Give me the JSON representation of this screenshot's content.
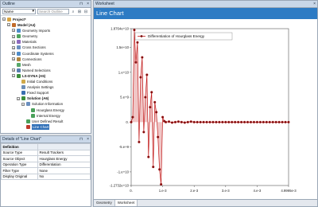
{
  "outline": {
    "title": "Outline",
    "pin": "⊓",
    "close": "×",
    "name_select": "Name",
    "search_placeholder": "Search Outline",
    "tree": [
      {
        "label": "Project*",
        "indent": 0,
        "exp": "−",
        "bold": true,
        "color": "#d9a441"
      },
      {
        "label": "Model (A4)",
        "indent": 1,
        "exp": "−",
        "bold": true,
        "color": "#c26b2a"
      },
      {
        "label": "Geometry Imports",
        "indent": 2,
        "exp": "+",
        "color": "#4f8cc9"
      },
      {
        "label": "Geometry",
        "indent": 2,
        "exp": "+",
        "color": "#4fa35f"
      },
      {
        "label": "Materials",
        "indent": 2,
        "exp": "+",
        "color": "#8e6bbf"
      },
      {
        "label": "Cross Sections",
        "indent": 2,
        "exp": "+",
        "color": "#6b8fbf"
      },
      {
        "label": "Coordinate Systems",
        "indent": 2,
        "exp": "+",
        "color": "#4f8cc9"
      },
      {
        "label": "Connections",
        "indent": 2,
        "exp": "+",
        "color": "#b0853f"
      },
      {
        "label": "Mesh",
        "indent": 2,
        "exp": "",
        "color": "#58a86a"
      },
      {
        "label": "Named Selections",
        "indent": 2,
        "exp": "+",
        "color": "#5a7fb0"
      },
      {
        "label": "LS-DYNA (A5)",
        "indent": 2,
        "exp": "−",
        "bold": true,
        "color": "#3d8f3d"
      },
      {
        "label": "Initial Conditions",
        "indent": 3,
        "exp": "",
        "color": "#d0a94a"
      },
      {
        "label": "Analysis Settings",
        "indent": 3,
        "exp": "",
        "color": "#6d8fb8"
      },
      {
        "label": "Fixed Support",
        "indent": 3,
        "exp": "",
        "color": "#3a6fb0"
      },
      {
        "label": "Solution (A6)",
        "indent": 3,
        "exp": "−",
        "bold": true,
        "color": "#3d8f3d"
      },
      {
        "label": "Solution Information",
        "indent": 4,
        "exp": "−",
        "color": "#6b8fbf"
      },
      {
        "label": "Hourglass Energy",
        "indent": 5,
        "exp": "",
        "color": "#4aa05a"
      },
      {
        "label": "Internal Energy",
        "indent": 5,
        "exp": "",
        "color": "#4aa05a"
      },
      {
        "label": "User Defined Result",
        "indent": 4,
        "exp": "",
        "color": "#4aa05a"
      },
      {
        "label": "Line Chart",
        "indent": 4,
        "exp": "",
        "selected": true,
        "color": "#c0392b"
      }
    ]
  },
  "details": {
    "title": "Details of \"Line Chart\"",
    "rows": [
      {
        "key": "Definition",
        "value": "",
        "group": true
      },
      {
        "key": "Source Type",
        "value": "Result Trackers"
      },
      {
        "key": "Source Object",
        "value": "Hourglass Energy"
      },
      {
        "key": "Operation Type",
        "value": "Differentiation"
      },
      {
        "key": "Filter Type",
        "value": "None"
      },
      {
        "key": "Display Original",
        "value": "No"
      }
    ]
  },
  "worksheet": {
    "title": "Worksheet",
    "header": "Line Chart",
    "tabs": [
      "Geometry",
      "Worksheet"
    ],
    "active_tab": 1
  },
  "colors": {
    "series": "#c21a1a",
    "marker": "#7a0f0f",
    "header": "#2d7bc4"
  },
  "chart_data": {
    "type": "line",
    "legend": "Differentiation of Hourglass Energy",
    "legend_position": "top-center",
    "grid": false,
    "xlim": [
      0,
      0.0049995
    ],
    "ylim": [
      -1.2732,
      1.8764
    ],
    "x_ticks": [
      {
        "value": 0,
        "label": "0."
      },
      {
        "value": 0.001,
        "label": "1.e-3"
      },
      {
        "value": 0.002,
        "label": "2.e-3"
      },
      {
        "value": 0.003,
        "label": "3.e-3"
      },
      {
        "value": 0.004,
        "label": "4.e-3"
      },
      {
        "value": 0.0049995,
        "label": "4.9995e-3"
      }
    ],
    "y_ticks": [
      {
        "value": 1.8764,
        "label": "1.8764e+10"
      },
      {
        "value": 1.5,
        "label": "1.5e+10"
      },
      {
        "value": 1.0,
        "label": "1.e+10"
      },
      {
        "value": 0.5,
        "label": "5.e+9"
      },
      {
        "value": 0,
        "label": "0."
      },
      {
        "value": -0.5,
        "label": "-5.e+9"
      },
      {
        "value": -1.0,
        "label": "-1.e+10"
      },
      {
        "value": -1.2732,
        "label": "-1.2732e+10"
      }
    ],
    "series": [
      {
        "name": "Differentiation of Hourglass Energy",
        "x": [
          0,
          5e-05,
          0.0001,
          0.00015,
          0.0002,
          0.00025,
          0.0003,
          0.00035,
          0.0004,
          0.00045,
          0.0005,
          0.00055,
          0.0006,
          0.00065,
          0.0007,
          0.00075,
          0.0008,
          0.00085,
          0.0009,
          0.00095,
          0.001,
          0.00105,
          0.0011,
          0.0012,
          0.0013,
          0.0014,
          0.0015,
          0.0016,
          0.0017,
          0.0018,
          0.0019,
          0.002,
          0.0021,
          0.0022,
          0.0023,
          0.0024,
          0.0025,
          0.0026,
          0.0027,
          0.0028,
          0.0029,
          0.003,
          0.0031,
          0.0032,
          0.0033,
          0.0034,
          0.0035,
          0.0036,
          0.0037,
          0.0038,
          0.0039,
          0.004,
          0.0041,
          0.0042,
          0.0043,
          0.0044,
          0.0045,
          0.0046,
          0.0047,
          0.0048,
          0.0049,
          0.0049995
        ],
        "values": [
          0,
          0.1,
          1.85,
          1.2,
          1.6,
          -0.4,
          0.9,
          1.3,
          -0.2,
          0.5,
          0.95,
          -0.7,
          0.3,
          0.6,
          -0.9,
          0.4,
          0.2,
          -0.3,
          -0.95,
          -1.25,
          0.1,
          0.02,
          0.0,
          0.01,
          -0.01,
          0.0,
          0.01,
          0.0,
          -0.01,
          0.0,
          0.01,
          0.0,
          0.0,
          0.0,
          0.0,
          0.0,
          0.0,
          0.0,
          0.0,
          0.0,
          0.0,
          0.0,
          0.0,
          0.0,
          0.0,
          0.0,
          0.0,
          0.0,
          0.0,
          0.0,
          0.0,
          0.0,
          0.0,
          0.0,
          0.0,
          0.0,
          0.0,
          0.0,
          0.0,
          0.0,
          0.0,
          0.0
        ]
      }
    ]
  }
}
